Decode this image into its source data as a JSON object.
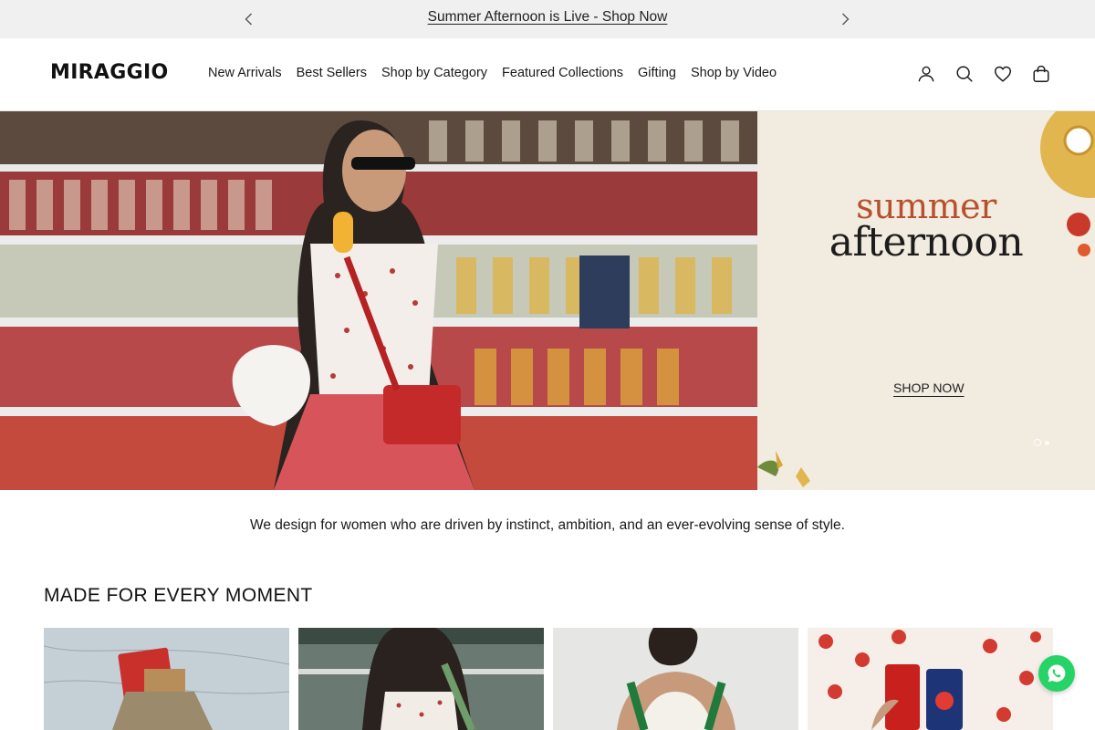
{
  "announcement": {
    "text": "Summer Afternoon is Live - Shop Now",
    "prev_icon": "chevron-left-icon",
    "next_icon": "chevron-right-icon"
  },
  "header": {
    "logo": "MIRAGGIO",
    "nav": [
      "New Arrivals",
      "Best Sellers",
      "Shop by Category",
      "Featured Collections",
      "Gifting",
      "Shop by Video"
    ],
    "icons": [
      "account-icon",
      "search-icon",
      "wishlist-icon",
      "cart-icon"
    ]
  },
  "hero": {
    "title_line1": "summer",
    "title_line2": "afternoon",
    "cta": "SHOP NOW",
    "slide_count": 2,
    "active_slide": 1,
    "accent_color": "#b8502d",
    "panel_color": "#f1ebe0"
  },
  "tagline": "We design for women who are driven by instinct, ambition, and an ever-evolving sense of style.",
  "section": {
    "title": "MADE FOR EVERY MOMENT"
  },
  "cards": [
    {
      "subject": "travel bag with passport on map"
    },
    {
      "subject": "model in store aisle"
    },
    {
      "subject": "model back view with green straps"
    },
    {
      "subject": "hands holding cans on polka dot dress"
    }
  ],
  "whatsapp": {
    "icon": "whatsapp-icon",
    "color": "#25d366"
  }
}
